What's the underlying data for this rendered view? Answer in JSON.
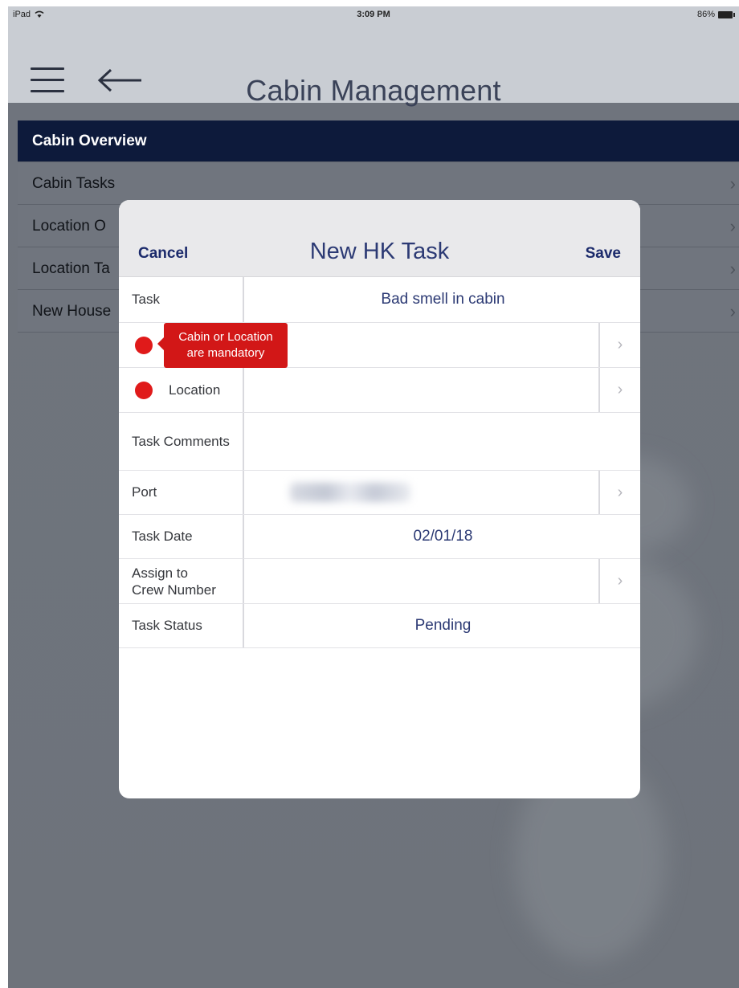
{
  "status_bar": {
    "device": "iPad",
    "time": "3:09 PM",
    "battery": "86%"
  },
  "nav": {
    "title": "Cabin Management"
  },
  "menu": {
    "items": [
      {
        "label": "Cabin Overview",
        "active": true
      },
      {
        "label": "Cabin Tasks",
        "active": false
      },
      {
        "label": "Location O",
        "active": false
      },
      {
        "label": "Location Ta",
        "active": false
      },
      {
        "label": "New House",
        "active": false
      }
    ],
    "chevron": "›"
  },
  "modal": {
    "title": "New HK Task",
    "cancel_label": "Cancel",
    "save_label": "Save",
    "rows": {
      "task": {
        "label": "Task",
        "value": "Bad smell in cabin"
      },
      "cabin": {
        "label": "",
        "value": ""
      },
      "location": {
        "label": "Location",
        "value": ""
      },
      "task_comments": {
        "label": "Task Comments",
        "value": ""
      },
      "port": {
        "label": "Port",
        "value": ""
      },
      "task_date": {
        "label": "Task Date",
        "value": "02/01/18"
      },
      "assign_crew": {
        "label_line1": "Assign to",
        "label_line2": "Crew Number",
        "value": ""
      },
      "task_status": {
        "label": "Task Status",
        "value": "Pending"
      }
    },
    "chevron": "›"
  },
  "tooltip": {
    "line1": "Cabin or Location",
    "line2": "are mandatory"
  },
  "colors": {
    "accent_navy": "#0d1a3b",
    "link_blue": "#1b2a6b",
    "error_red": "#e01a1a",
    "overlay": "#6f747d"
  },
  "icons": [
    "wifi-icon",
    "battery-icon",
    "hamburger-menu-icon",
    "back-arrow-icon",
    "chevron-right-icon",
    "required-dot-icon"
  ]
}
